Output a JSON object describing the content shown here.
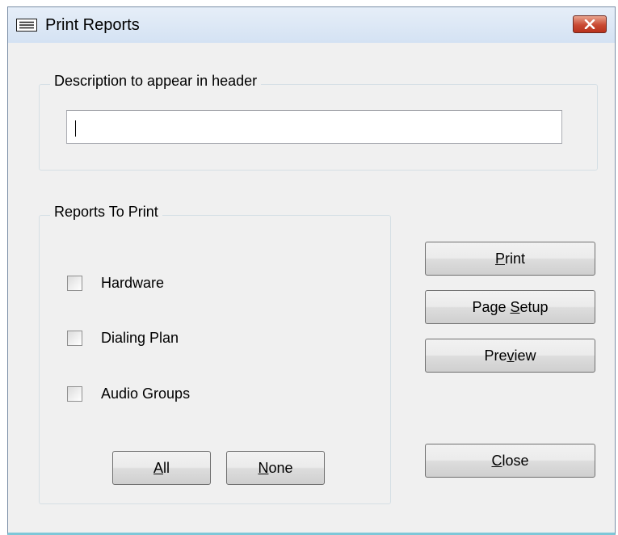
{
  "window": {
    "title": "Print Reports",
    "title_icon": "form-icon",
    "close_icon": "close-icon",
    "close_color": "#c94a33"
  },
  "description": {
    "label": "Description to appear in header",
    "value": "",
    "placeholder": ""
  },
  "reports": {
    "label": "Reports To Print",
    "items": [
      {
        "label": "Hardware",
        "checked": false
      },
      {
        "label": "Dialing Plan",
        "checked": false
      },
      {
        "label": "Audio Groups",
        "checked": false
      }
    ],
    "all_button": {
      "before": "",
      "mnemonic": "A",
      "after": "ll"
    },
    "none_button": {
      "before": "",
      "mnemonic": "N",
      "after": "one"
    }
  },
  "actions": {
    "print": {
      "before": "",
      "mnemonic": "P",
      "after": "rint"
    },
    "page_setup": {
      "before": "Page ",
      "mnemonic": "S",
      "after": "etup"
    },
    "preview": {
      "before": "Pre",
      "mnemonic": "v",
      "after": "iew"
    },
    "close": {
      "before": "",
      "mnemonic": "C",
      "after": "lose"
    }
  }
}
